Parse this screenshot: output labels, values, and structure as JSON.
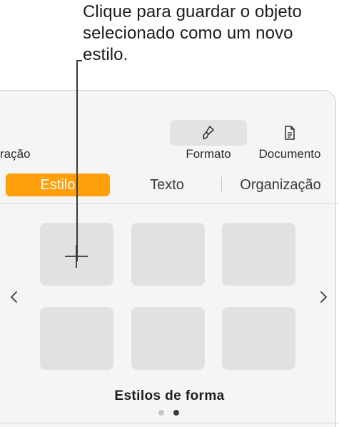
{
  "callout": {
    "text": "Clique para guardar o objeto selecionado como um novo estilo."
  },
  "toolbar": {
    "left_partial_label": "ração",
    "format": {
      "label": "Formato",
      "icon": "paintbrush-icon"
    },
    "document": {
      "label": "Documento",
      "icon": "document-icon"
    }
  },
  "tabs": [
    {
      "label": "Estilo",
      "selected": true
    },
    {
      "label": "Texto",
      "selected": false
    },
    {
      "label": "Organização",
      "selected": false
    }
  ],
  "styles_grid": {
    "swatches": 6,
    "add_icon": "plus-icon"
  },
  "navigation": {
    "prev_icon": "chevron-left-icon",
    "next_icon": "chevron-right-icon"
  },
  "section": {
    "label": "Estilos de forma"
  },
  "pagination": {
    "pages": 2,
    "current": 2
  },
  "colors": {
    "accent": "#ff9f0a",
    "panel_bg": "#f5f5f5",
    "swatch_bg": "#e1e1e1"
  }
}
